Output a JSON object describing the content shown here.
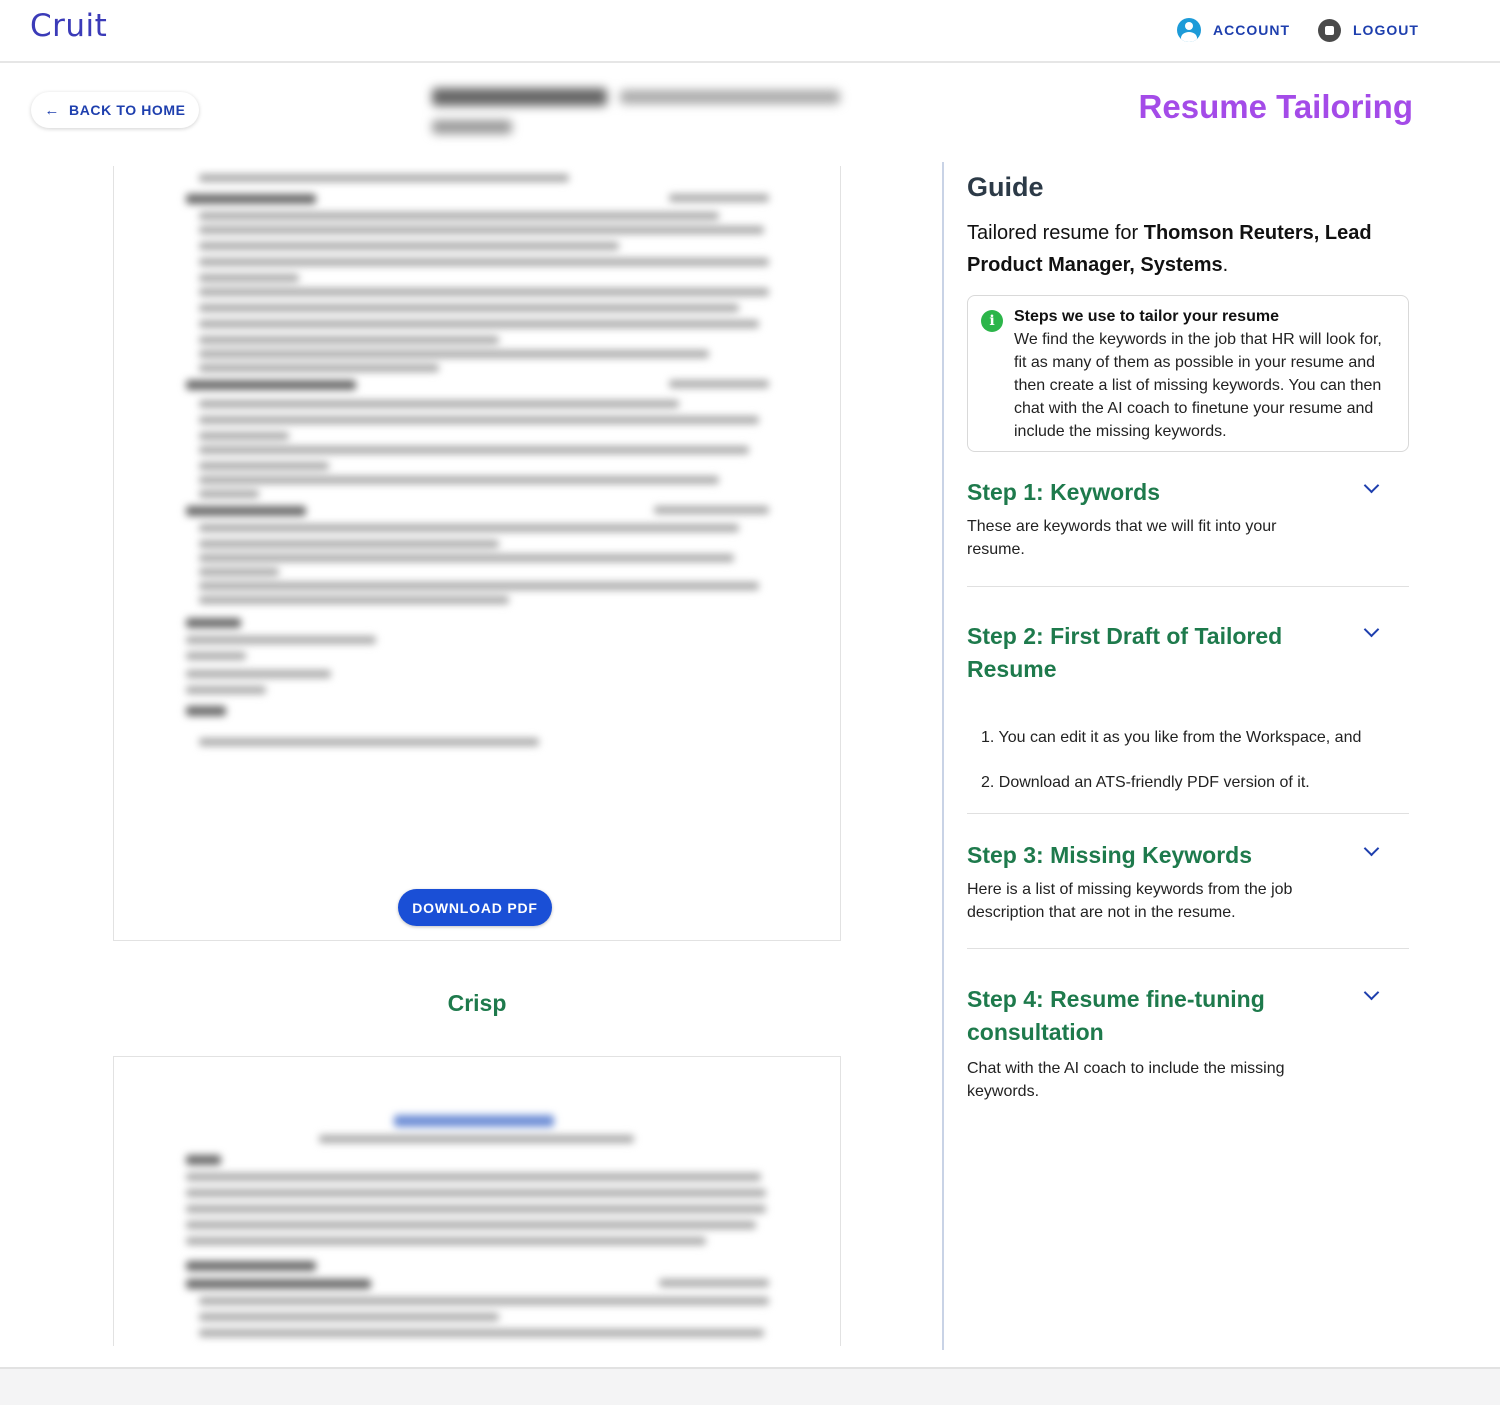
{
  "header": {
    "logo": "Cruit",
    "account_label": "ACCOUNT",
    "logout_label": "LOGOUT",
    "account_icon": "user-circle-icon",
    "logout_icon": "stop-circle-icon"
  },
  "toolbar": {
    "back_label": "BACK TO HOME",
    "back_icon": "arrow-left-icon",
    "page_title": "Resume Tailoring"
  },
  "resume_panel": {
    "download_label": "DOWNLOAD PDF",
    "template_name": "Crisp"
  },
  "guide": {
    "title": "Guide",
    "subtitle_prefix": "Tailored resume for ",
    "subtitle_bold": "Thomson Reuters, Lead Product Manager, Systems",
    "subtitle_suffix": ".",
    "info_title": "Steps we use to tailor your resume",
    "info_text": "We find the keywords in the job that HR will look for, fit as many of them as possible in your resume and then create a list of missing keywords. You can then chat with the AI coach to finetune your resume and include the missing keywords.",
    "steps": [
      {
        "title": "Step 1: Keywords",
        "desc": "These are keywords that we will fit into your resume."
      },
      {
        "title": "Step 2: First Draft of Tailored Resume",
        "items": [
          "1. You can edit it as you like from the Workspace, and",
          "2. Download an ATS-friendly PDF version of it."
        ]
      },
      {
        "title": "Step 3: Missing Keywords",
        "desc": "Here is a list of missing keywords from the job description that are not in the resume."
      },
      {
        "title": "Step 4: Resume fine-tuning consultation",
        "desc": "Chat with the AI coach to include the missing keywords."
      }
    ]
  },
  "colors": {
    "brand": "#3b3bb8",
    "accent_blue": "#1a4fd6",
    "heading_purple": "#a44be8",
    "step_green": "#1e7a4c",
    "info_green": "#2cb54a"
  }
}
